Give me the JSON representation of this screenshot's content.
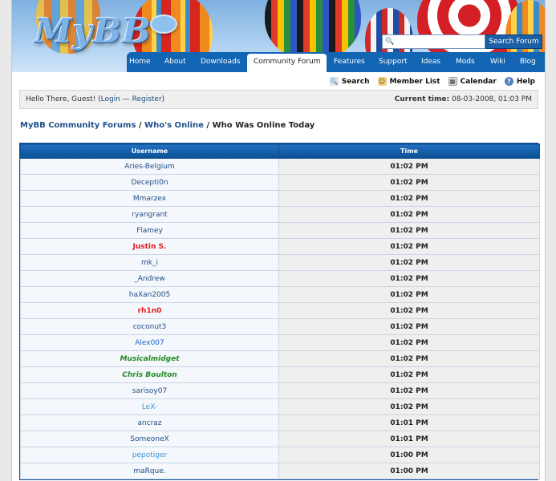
{
  "brand": {
    "logo_text": "MyBB"
  },
  "search": {
    "placeholder": "",
    "button_label": "Search Forum"
  },
  "nav": {
    "items": [
      "Home",
      "About",
      "Downloads",
      "Community Forum",
      "Features",
      "Support",
      "Ideas",
      "Mods",
      "Wiki",
      "Blog"
    ],
    "active": "Community Forum"
  },
  "toplinks": {
    "search": "Search",
    "member_list": "Member List",
    "calendar": "Calendar",
    "help": "Help"
  },
  "welcome": {
    "greeting": "Hello There, Guest! (",
    "login": "Login",
    "separator": " — ",
    "register": "Register",
    "closing": ")",
    "time_label": "Current time:",
    "time_value": " 08-03-2008, 01:03 PM"
  },
  "breadcrumb": {
    "crumb1": "MyBB Community Forums",
    "crumb2": "Who's Online",
    "current": "Who Was Online Today",
    "sep": " / "
  },
  "table": {
    "headers": {
      "username": "Username",
      "time": "Time"
    },
    "rows": [
      {
        "username": "Aries-Belgium",
        "time": "01:02 PM",
        "style": "normal"
      },
      {
        "username": "Decepti0n",
        "time": "01:02 PM",
        "style": "normal"
      },
      {
        "username": "Mmarzex",
        "time": "01:02 PM",
        "style": "normal"
      },
      {
        "username": "ryangrant",
        "time": "01:02 PM",
        "style": "normal"
      },
      {
        "username": "Flamey",
        "time": "01:02 PM",
        "style": "normal"
      },
      {
        "username": "Justin S.",
        "time": "01:02 PM",
        "style": "admin"
      },
      {
        "username": "mk_i",
        "time": "01:02 PM",
        "style": "normal"
      },
      {
        "username": "_Andrew",
        "time": "01:02 PM",
        "style": "normal"
      },
      {
        "username": "haXan2005",
        "time": "01:02 PM",
        "style": "normal"
      },
      {
        "username": "rh1n0",
        "time": "01:02 PM",
        "style": "admin"
      },
      {
        "username": "coconut3",
        "time": "01:02 PM",
        "style": "normal"
      },
      {
        "username": "Alex007",
        "time": "01:02 PM",
        "style": "blue"
      },
      {
        "username": "Musicalmidget",
        "time": "01:02 PM",
        "style": "mod"
      },
      {
        "username": "Chris Boulton",
        "time": "01:02 PM",
        "style": "mod"
      },
      {
        "username": "sarisoy07",
        "time": "01:02 PM",
        "style": "normal"
      },
      {
        "username": "LeX-",
        "time": "01:02 PM",
        "style": "light"
      },
      {
        "username": "ancraz",
        "time": "01:01 PM",
        "style": "normal"
      },
      {
        "username": "SomeoneX",
        "time": "01:01 PM",
        "style": "normal"
      },
      {
        "username": "pepotiger",
        "time": "01:00 PM",
        "style": "light"
      },
      {
        "username": "maRque.",
        "time": "01:00 PM",
        "style": "normal"
      }
    ]
  },
  "colors": {
    "nav_bg": "#1265b3",
    "link": "#1f4e86",
    "admin": "#e31b1b",
    "moderator": "#228b22",
    "header_bg": "#0b4f93"
  }
}
